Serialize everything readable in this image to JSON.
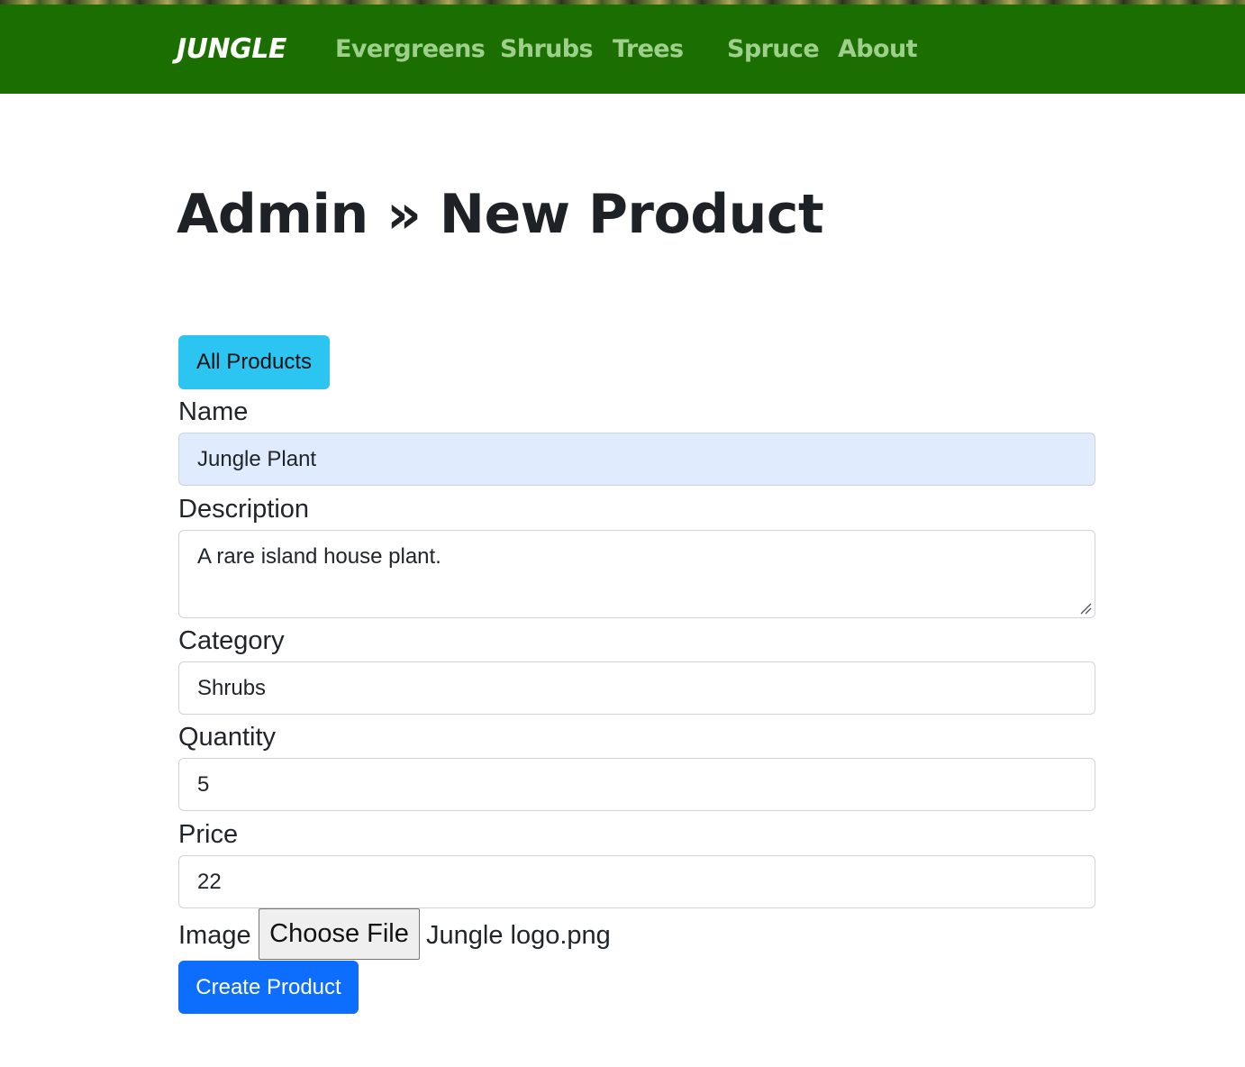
{
  "navbar": {
    "brand": "JUNGLE",
    "links": [
      "Evergreens",
      "Shrubs",
      "Trees",
      "Spruce",
      "About"
    ],
    "background": "#1b6e00",
    "link_color": "#9ed08c"
  },
  "page": {
    "title": "Admin » New Product"
  },
  "actions": {
    "all_products_label": "All Products",
    "create_label": "Create Product"
  },
  "form": {
    "name_label": "Name",
    "name_value": "Jungle Plant",
    "description_label": "Description",
    "description_value": "A rare island house plant.",
    "category_label": "Category",
    "category_value": "Shrubs",
    "quantity_label": "Quantity",
    "quantity_value": "5",
    "price_label": "Price",
    "price_value": "22",
    "image_label": "Image",
    "choose_file_label": "Choose File",
    "file_name": "Jungle logo.png"
  },
  "colors": {
    "info_button": "#2cc4f0",
    "primary_button": "#0d6efd",
    "autofill_bg": "#e0ebfd"
  }
}
